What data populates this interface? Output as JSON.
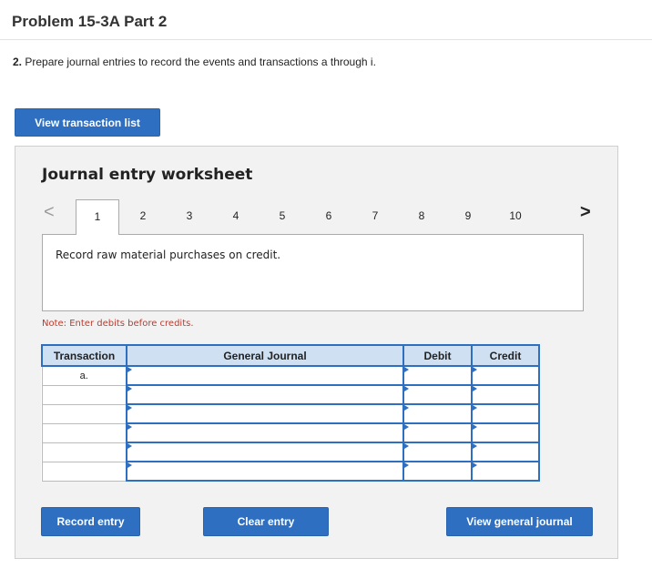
{
  "header": {
    "title": "Problem 15-3A Part 2",
    "instruction_number": "2.",
    "instruction_text": " Prepare journal entries to record the events and transactions a through i."
  },
  "buttons": {
    "view_transaction_list": "View transaction list",
    "record_entry": "Record entry",
    "clear_entry": "Clear entry",
    "view_general_journal": "View general journal"
  },
  "worksheet": {
    "title": "Journal entry worksheet",
    "prev_arrow": "<",
    "next_arrow": ">",
    "tabs": [
      "1",
      "2",
      "3",
      "4",
      "5",
      "6",
      "7",
      "8",
      "9",
      "10"
    ],
    "active_tab": "1",
    "description": "Record raw material purchases on credit.",
    "note": "Note: Enter debits before credits."
  },
  "table": {
    "headers": {
      "transaction": "Transaction",
      "general_journal": "General Journal",
      "debit": "Debit",
      "credit": "Credit"
    },
    "rows": [
      {
        "transaction": "a.",
        "account": "",
        "debit": "",
        "credit": ""
      },
      {
        "transaction": "",
        "account": "",
        "debit": "",
        "credit": ""
      },
      {
        "transaction": "",
        "account": "",
        "debit": "",
        "credit": ""
      },
      {
        "transaction": "",
        "account": "",
        "debit": "",
        "credit": ""
      },
      {
        "transaction": "",
        "account": "",
        "debit": "",
        "credit": ""
      },
      {
        "transaction": "",
        "account": "",
        "debit": "",
        "credit": ""
      }
    ]
  },
  "colors": {
    "accent": "#2f6fc2",
    "note": "#c0392b",
    "header_fill": "#cfe0f2",
    "panel_bg": "#f2f2f2"
  }
}
